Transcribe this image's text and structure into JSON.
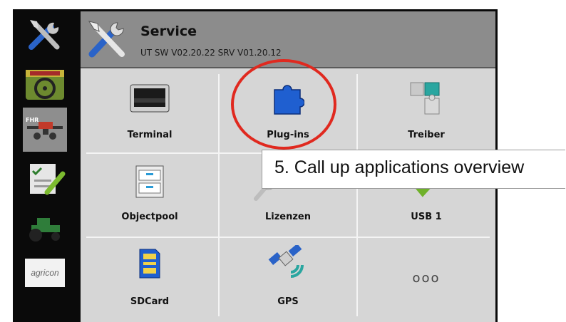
{
  "header": {
    "title": "Service",
    "subtitle": "UT SW V02.20.22 SRV V01.20.12",
    "icon": "tools-icon"
  },
  "sidebar": {
    "items": [
      {
        "icon": "tools-icon",
        "selected": false
      },
      {
        "icon": "steering-wheel-icon",
        "selected": false
      },
      {
        "icon": "sprayer-icon",
        "label": "FHR",
        "selected": true
      },
      {
        "icon": "checklist-icon",
        "selected": false
      },
      {
        "icon": "tractor-icon",
        "selected": false
      },
      {
        "icon": "agricon-logo",
        "label": "agricon",
        "selected": false
      }
    ]
  },
  "tiles": [
    {
      "label": "Terminal",
      "icon": "terminal-icon"
    },
    {
      "label": "Plug-ins",
      "icon": "puzzle-piece-icon"
    },
    {
      "label": "Treiber",
      "icon": "puzzle-pieces-icon"
    },
    {
      "label": "Objectpool",
      "icon": "drawer-cabinet-icon"
    },
    {
      "label": "Lizenzen",
      "icon": "key-icon"
    },
    {
      "label": "USB 1",
      "icon": "usb-check-icon"
    },
    {
      "label": "SDCard",
      "icon": "sd-card-icon"
    },
    {
      "label": "GPS",
      "icon": "satellite-icon"
    },
    {
      "label": "ooo",
      "icon": "more-icon"
    }
  ],
  "callout": {
    "text": "5. Call up applications overview",
    "highlight_color": "#e0291f"
  }
}
